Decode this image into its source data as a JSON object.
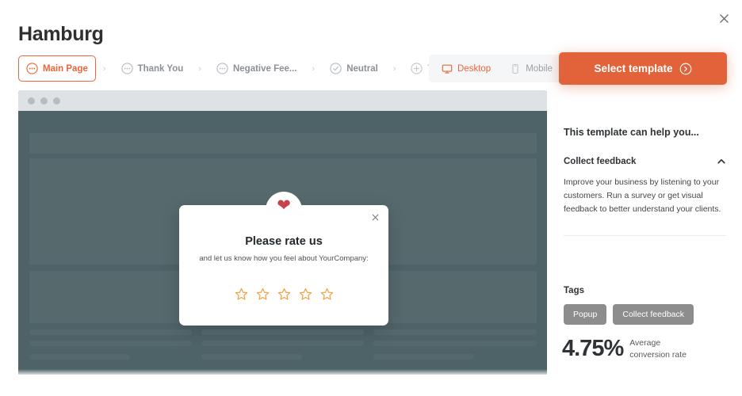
{
  "window": {
    "close_icon": "close-icon"
  },
  "header": {
    "title": "Hamburg"
  },
  "breadcrumb": {
    "items": [
      {
        "label": "Main Page",
        "icon": "dots-circle-icon",
        "state": "active"
      },
      {
        "label": "Thank You",
        "icon": "dots-circle-icon",
        "state": "default"
      },
      {
        "label": "Negative Fee...",
        "icon": "dots-circle-icon",
        "state": "default"
      },
      {
        "label": "Neutral",
        "icon": "check-circle-icon",
        "state": "default"
      },
      {
        "label": "Teaser",
        "icon": "plus-circle-icon",
        "state": "muted"
      }
    ],
    "separator": "›"
  },
  "devices": {
    "options": [
      {
        "label": "Desktop",
        "icon": "desktop-icon",
        "active": true
      },
      {
        "label": "Mobile",
        "icon": "mobile-icon",
        "active": false
      }
    ]
  },
  "actions": {
    "select_template_label": "Select template",
    "select_template_icon": "arrow-right-circle-icon"
  },
  "preview": {
    "popup": {
      "heart_icon": "heart-icon",
      "close_icon": "close-icon",
      "title": "Please rate us",
      "subtitle": "and let us know how you feel about YourCompany:",
      "stars": 5,
      "star_icon": "star-outline-icon",
      "star_color": "#f2a03d"
    }
  },
  "sidebar": {
    "heading": "This template can help you...",
    "accordion": {
      "title": "Collect feedback",
      "chevron_icon": "chevron-up-icon",
      "expanded": true,
      "body": "Improve your business by listening to your customers. Run a survey or get visual feedback to better understand your clients."
    },
    "tags_heading": "Tags",
    "tags": [
      "Popup",
      "Collect feedback"
    ],
    "stat": {
      "value": "4.75%",
      "label_line1": "Average",
      "label_line2": "conversion rate"
    }
  },
  "colors": {
    "accent": "#e2623a",
    "accent_text": "#e8663a",
    "preview_bg": "#4e6367",
    "chrome_bg": "#dfe2e5",
    "tag_bg": "#8d8d8d",
    "heart": "#c8424a",
    "star": "#f2a03d"
  }
}
